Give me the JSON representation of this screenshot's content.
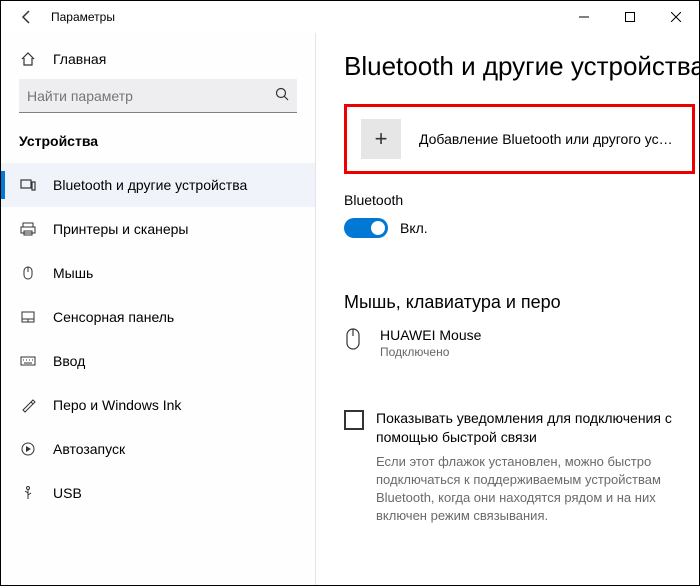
{
  "titlebar": {
    "title": "Параметры"
  },
  "sidebar": {
    "home_label": "Главная",
    "search_placeholder": "Найти параметр",
    "section": "Устройства",
    "items": [
      {
        "label": "Bluetooth и другие устройства"
      },
      {
        "label": "Принтеры и сканеры"
      },
      {
        "label": "Мышь"
      },
      {
        "label": "Сенсорная панель"
      },
      {
        "label": "Ввод"
      },
      {
        "label": "Перо и Windows Ink"
      },
      {
        "label": "Автозапуск"
      },
      {
        "label": "USB"
      }
    ]
  },
  "content": {
    "page_title": "Bluetooth и другие устройства",
    "add_device_label": "Добавление Bluetooth или другого устройс…",
    "bluetooth_label": "Bluetooth",
    "toggle_state": "Вкл.",
    "sub_section": "Мышь, клавиатура и перо",
    "device": {
      "name": "HUAWEI  Mouse",
      "status": "Подключено"
    },
    "checkbox_label": "Показывать уведомления для подключения с помощью быстрой связи",
    "hint": "Если этот флажок установлен, можно быстро подключаться к поддерживаемым устройствам Bluetooth, когда они находятся рядом и на них включен режим связывания."
  }
}
